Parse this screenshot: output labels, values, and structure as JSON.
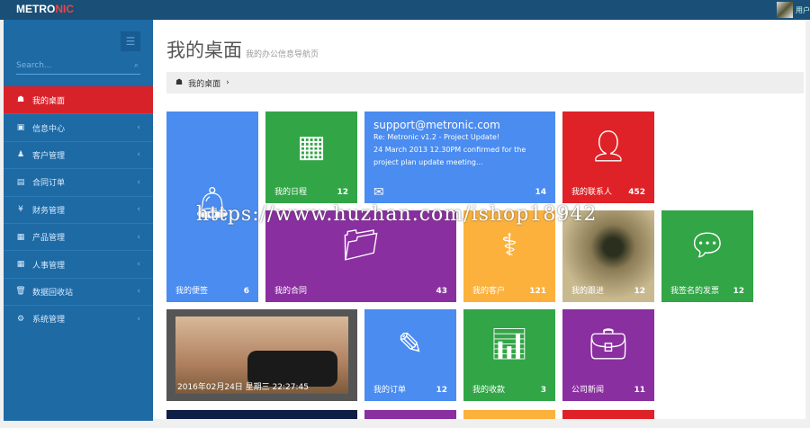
{
  "header": {
    "logo_a": "METRO",
    "logo_b": "NIC",
    "user": "用户"
  },
  "sidebar": {
    "search_placeholder": "Search...",
    "items": [
      {
        "label": "我的桌面",
        "icon": "☗"
      },
      {
        "label": "信息中心",
        "icon": "▣"
      },
      {
        "label": "客户管理",
        "icon": "♟"
      },
      {
        "label": "合同订单",
        "icon": "▤"
      },
      {
        "label": "财务管理",
        "icon": "¥"
      },
      {
        "label": "产品管理",
        "icon": "▦"
      },
      {
        "label": "人事管理",
        "icon": "▦"
      },
      {
        "label": "数据回收站",
        "icon": "🗑"
      },
      {
        "label": "系统管理",
        "icon": "⚙"
      }
    ]
  },
  "page": {
    "title": "我的桌面",
    "subtitle": "我的办公信息导航页",
    "breadcrumb": "我的桌面"
  },
  "tiles": {
    "notes": {
      "label": "我的便签",
      "count": "6"
    },
    "schedule": {
      "label": "我的日程",
      "count": "12"
    },
    "mail": {
      "from": "support@metronic.com",
      "subject": "Re: Metronic v1.2 - Project Update!",
      "line2": "24 March 2013 12.30PM confirmed for the",
      "line3": "project plan update meeting...",
      "count": "14"
    },
    "contacts": {
      "label": "我的联系人",
      "count": "452"
    },
    "contracts": {
      "label": "我的合同",
      "count": "43"
    },
    "customers": {
      "label": "我的客户",
      "count": "121"
    },
    "followups": {
      "label": "我的跟进",
      "count": "12"
    },
    "invoices": {
      "label": "我签名的发票",
      "count": "12"
    },
    "datetime": "2016年02月24日 星期三 22:27:45",
    "orders": {
      "label": "我的订单",
      "count": "12"
    },
    "payments": {
      "label": "我的收款",
      "count": "3"
    },
    "news": {
      "label": "公司新闻",
      "count": "11"
    }
  },
  "watermark": "https://www.huzhan.com/ishop18942"
}
